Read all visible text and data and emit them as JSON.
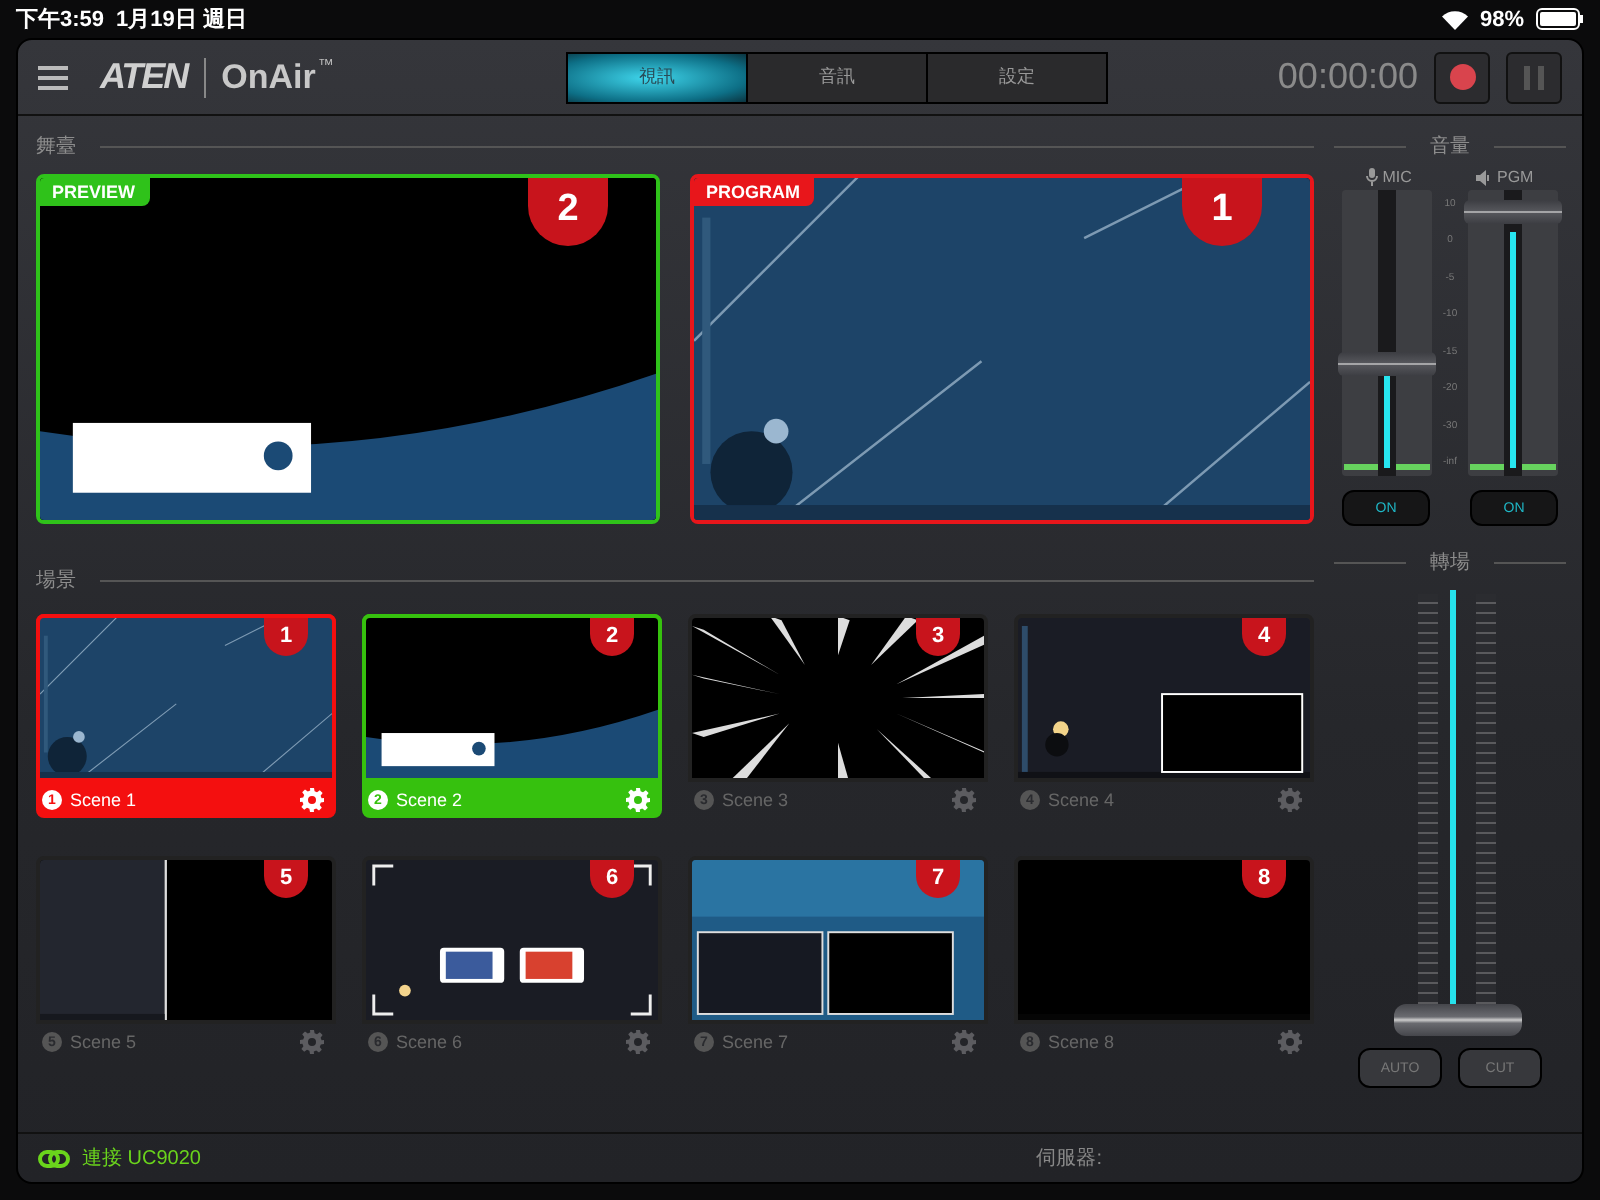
{
  "status_bar": {
    "time": "下午3:59",
    "date": "1月19日 週日",
    "battery": "98%"
  },
  "header": {
    "logo": "ATEN",
    "product": "OnAir",
    "trademark": "™",
    "timer": "00:00:00",
    "tabs": [
      {
        "label": "視訊",
        "selected": true
      },
      {
        "label": "音訊",
        "selected": false
      },
      {
        "label": "設定",
        "selected": false
      }
    ]
  },
  "stage": {
    "title": "舞臺",
    "monitors": [
      {
        "kind": "preview",
        "label": "PREVIEW",
        "number": "2",
        "color": "#2fc21a"
      },
      {
        "kind": "program",
        "label": "PROGRAM",
        "number": "1",
        "color": "#e8161b"
      }
    ]
  },
  "volume": {
    "title": "音量",
    "scale": [
      "10",
      "0",
      "-5",
      "-10",
      "-15",
      "-20",
      "-30",
      "-inf"
    ],
    "channels": [
      {
        "kind": "mic",
        "name": "MIC",
        "level": 0.38,
        "on": true,
        "button": "ON"
      },
      {
        "kind": "speaker",
        "name": "PGM",
        "level": 0.96,
        "on": true,
        "button": "ON"
      }
    ]
  },
  "transition": {
    "title": "轉場",
    "level": 0,
    "buttons": [
      "AUTO",
      "CUT"
    ]
  },
  "scenes": {
    "title": "場景",
    "items": [
      {
        "number": "1",
        "index_mark": "1",
        "name": "Scene 1",
        "program": true,
        "preview": false
      },
      {
        "number": "2",
        "index_mark": "2",
        "name": "Scene 2",
        "program": false,
        "preview": true
      },
      {
        "number": "3",
        "index_mark": "3",
        "name": "Scene 3",
        "program": false,
        "preview": false
      },
      {
        "number": "4",
        "index_mark": "4",
        "name": "Scene 4",
        "program": false,
        "preview": false
      },
      {
        "number": "5",
        "index_mark": "5",
        "name": "Scene 5",
        "program": false,
        "preview": false
      },
      {
        "number": "6",
        "index_mark": "6",
        "name": "Scene 6",
        "program": false,
        "preview": false
      },
      {
        "number": "7",
        "index_mark": "7",
        "name": "Scene 7",
        "program": false,
        "preview": false
      },
      {
        "number": "8",
        "index_mark": "8",
        "name": "Scene 8",
        "program": false,
        "preview": false
      }
    ]
  },
  "footer": {
    "connection": "連接 UC9020",
    "server_label": "伺服器:"
  }
}
